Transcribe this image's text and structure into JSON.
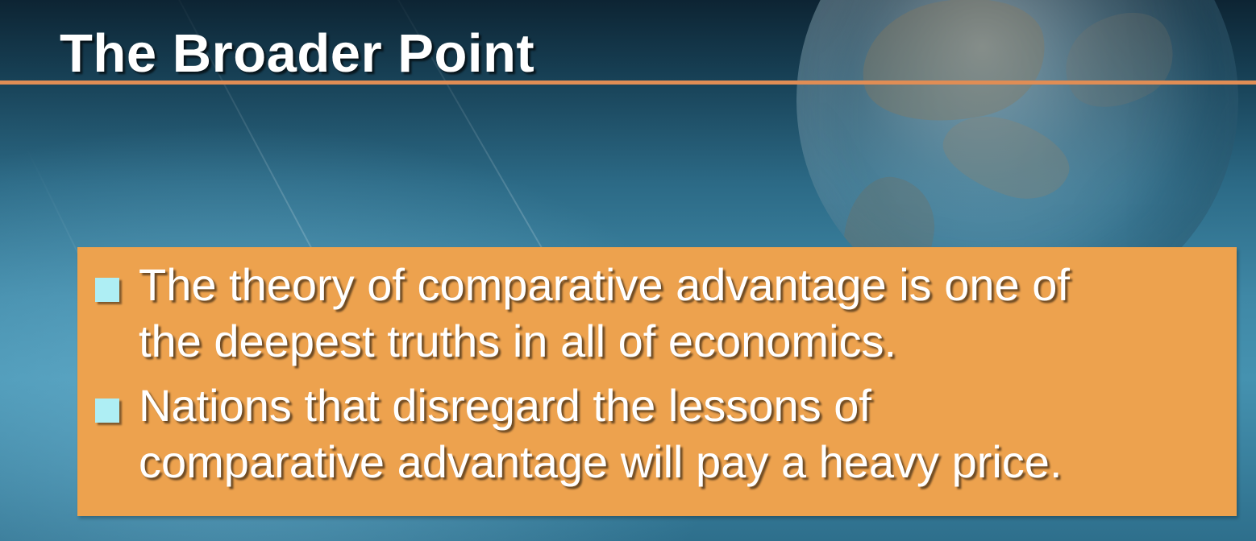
{
  "slide": {
    "title": "The Broader Point",
    "bullets": [
      {
        "line1": "The theory of comparative advantage is one of",
        "line2": "the deepest truths in all of economics."
      },
      {
        "line1": "Nations that disregard the lessons of",
        "line2": "comparative advantage will pay a heavy price."
      }
    ]
  },
  "colors": {
    "accent_rule": "#e08d55",
    "content_box": "#eda24e",
    "bullet_marker": "#aeeef4",
    "text": "#ffffff"
  },
  "icons": {
    "bullet": "square-bullet-icon",
    "background_decoration": "globe-icon"
  }
}
